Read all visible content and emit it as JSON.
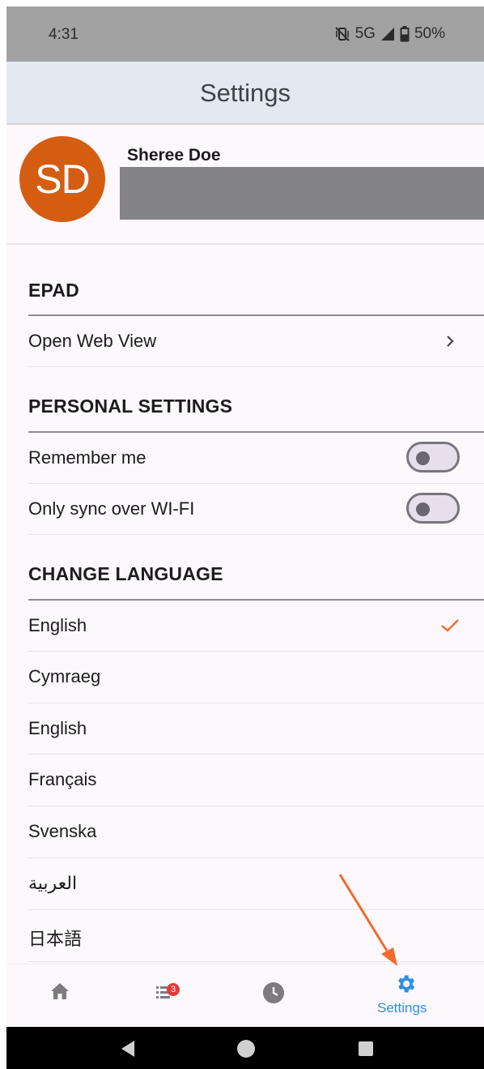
{
  "status_bar": {
    "time": "4:31",
    "network": "5G",
    "battery": "50%"
  },
  "app_bar": {
    "title": "Settings"
  },
  "profile": {
    "initials": "SD",
    "name": "Sheree Doe",
    "avatar_color": "#d45d12"
  },
  "sections": {
    "epad": {
      "title": "EPAD",
      "items": [
        {
          "label": "Open Web View"
        }
      ]
    },
    "personal": {
      "title": "PERSONAL SETTINGS",
      "items": [
        {
          "label": "Remember me",
          "enabled": false
        },
        {
          "label": "Only sync over WI-FI",
          "enabled": false
        }
      ]
    },
    "language": {
      "title": "CHANGE LANGUAGE",
      "items": [
        {
          "label": "English",
          "selected": true
        },
        {
          "label": "Cymraeg"
        },
        {
          "label": "English"
        },
        {
          "label": "Français"
        },
        {
          "label": "Svenska"
        },
        {
          "label": "العربية"
        },
        {
          "label": "日本語"
        }
      ]
    }
  },
  "bottom_nav": {
    "items": [
      {
        "icon": "home-icon"
      },
      {
        "icon": "list-icon",
        "badge": "3"
      },
      {
        "icon": "clock-icon"
      },
      {
        "icon": "gear-icon",
        "label": "Settings",
        "active": true
      }
    ]
  },
  "colors": {
    "accent": "#2f8ee6",
    "check": "#f26a2e",
    "annotation_arrow": "#f26a2e"
  }
}
